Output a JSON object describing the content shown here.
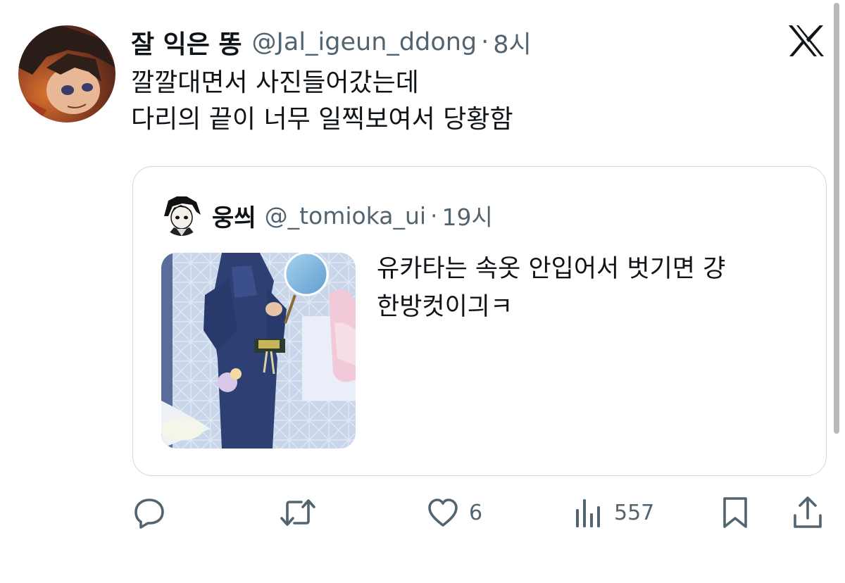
{
  "tweet": {
    "display_name": "잘 익은 똥",
    "handle": "@Jal_igeun_ddong",
    "separator": "·",
    "time": "8시",
    "text_lines": [
      "깔깔대면서 사진들어갔는데",
      "다리의 끝이 너무 일찍보여서 당황함"
    ]
  },
  "quote": {
    "display_name": "웅씌",
    "handle": "@_tomioka_ui",
    "separator": "·",
    "time": "19시",
    "text_lines": [
      "유카타는 속옷 안입어서 벗기면 걍",
      "한방컷이긔ㅋ"
    ]
  },
  "actions": {
    "reply_count": "",
    "retweet_count": "",
    "like_count": "6",
    "views_count": "557"
  },
  "colors": {
    "text": "#0f1419",
    "secondary": "#536471",
    "border": "#cfd9de"
  },
  "icons": [
    "x-logo-icon",
    "reply-icon",
    "retweet-icon",
    "like-icon",
    "views-icon",
    "bookmark-icon",
    "share-icon"
  ]
}
